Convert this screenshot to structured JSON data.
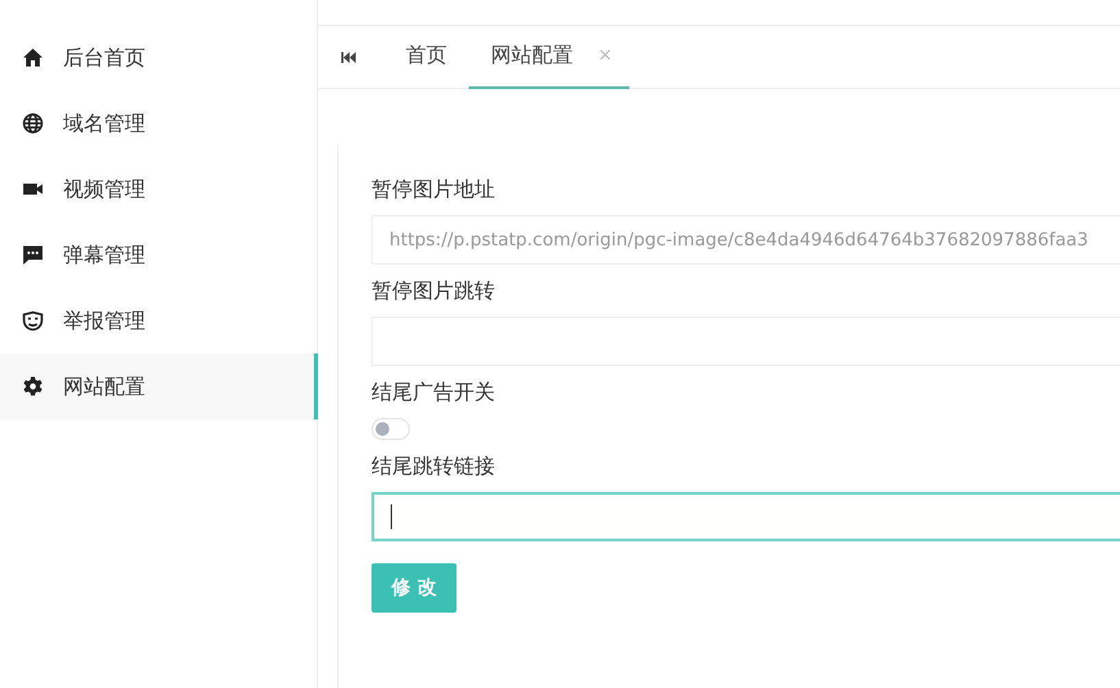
{
  "sidebar": {
    "items": [
      {
        "label": "后台首页",
        "selected": false
      },
      {
        "label": "域名管理",
        "selected": false
      },
      {
        "label": "视频管理",
        "selected": false
      },
      {
        "label": "弹幕管理",
        "selected": false
      },
      {
        "label": "举报管理",
        "selected": false
      },
      {
        "label": "网站配置",
        "selected": true
      }
    ]
  },
  "tabs": [
    {
      "label": "首页",
      "selected": false
    },
    {
      "label": "网站配置",
      "selected": true,
      "close": "×"
    }
  ],
  "form": {
    "fields": [
      {
        "kind": "text",
        "label": "暂停图片地址",
        "value": "https://p.pstatp.com/origin/pgc-image/c8e4da4946d64764b37682097886faa3",
        "focused": false
      },
      {
        "kind": "text",
        "label": "暂停图片跳转",
        "focused": false
      },
      {
        "kind": "switch",
        "label": "结尾广告开关",
        "on": false
      },
      {
        "kind": "text",
        "label": "结尾跳转链接",
        "focused": true
      }
    ],
    "submit": "修 改"
  }
}
